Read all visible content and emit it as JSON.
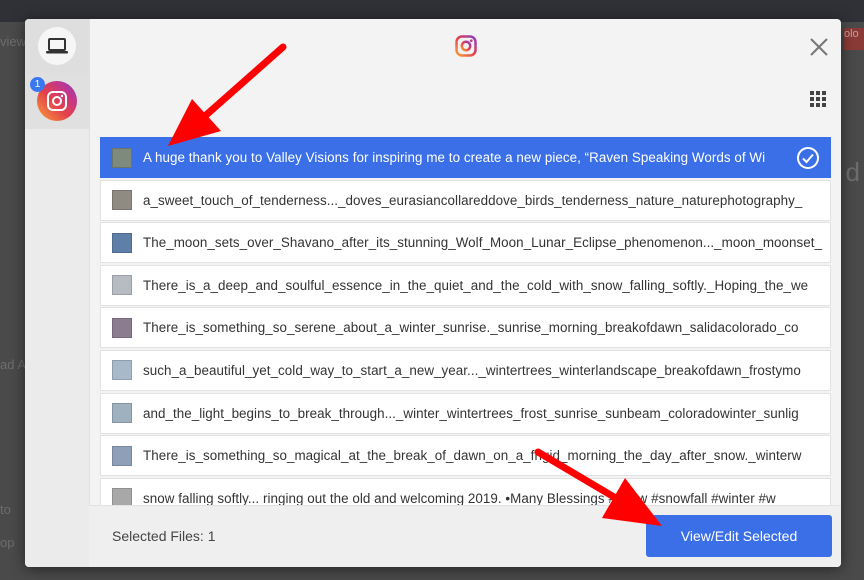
{
  "background": {
    "left_text_1": "ad A",
    "left_text_2": "to",
    "left_text_3": "op",
    "right_big_text": "d",
    "badge_text": "olo",
    "view_text": "view"
  },
  "sidebar": {
    "sources": [
      {
        "name": "device",
        "icon": "laptop-icon"
      },
      {
        "name": "instagram",
        "icon": "instagram-icon",
        "badge": "1"
      }
    ]
  },
  "header": {
    "icon": "instagram-icon"
  },
  "files": [
    {
      "name": "A huge thank you to Valley Visions for inspiring me to create a new piece, “Raven Speaking Words of Wi",
      "selected": true,
      "thumb": "#7d8a7c"
    },
    {
      "name": "a_sweet_touch_of_tenderness..._doves_eurasiancollareddove_birds_tenderness_nature_naturephotography_",
      "selected": false,
      "thumb": "#8f8a82"
    },
    {
      "name": "The_moon_sets_over_Shavano_after_its_stunning_Wolf_Moon_Lunar_Eclipse_phenomenon..._moon_moonset_",
      "selected": false,
      "thumb": "#5d7fa8"
    },
    {
      "name": "There_is_a_deep_and_soulful_essence_in_the_quiet_and_the_cold_with_snow_falling_softly._Hoping_the_we",
      "selected": false,
      "thumb": "#b7bcc3"
    },
    {
      "name": "There_is_something_so_serene_about_a_winter_sunrise._sunrise_morning_breakofdawn_salidacolorado_co",
      "selected": false,
      "thumb": "#8c7c8f"
    },
    {
      "name": "such_a_beautiful_yet_cold_way_to_start_a_new_year..._wintertrees_winterlandscape_breakofdawn_frostymo",
      "selected": false,
      "thumb": "#a9b9cc"
    },
    {
      "name": "and_the_light_begins_to_break_through..._winter_wintertrees_frost_sunrise_sunbeam_coloradowinter_sunlig",
      "selected": false,
      "thumb": "#9fb0bf"
    },
    {
      "name": "There_is_something_so_magical_at_the_break_of_dawn_on_a_frigid_morning_the_day_after_snow._winterw",
      "selected": false,
      "thumb": "#8da0b8"
    },
    {
      "name": "snow falling softly... ringing out the old and welcoming 2019. •Many Blessings #snow #snowfall #winter #w",
      "selected": false,
      "thumb": "#a8a8a8"
    }
  ],
  "footer": {
    "selected_label": "Selected Files: 1",
    "button_label": "View/Edit Selected"
  },
  "colors": {
    "accent": "#3a6fe8",
    "arrow": "#ff0000"
  }
}
